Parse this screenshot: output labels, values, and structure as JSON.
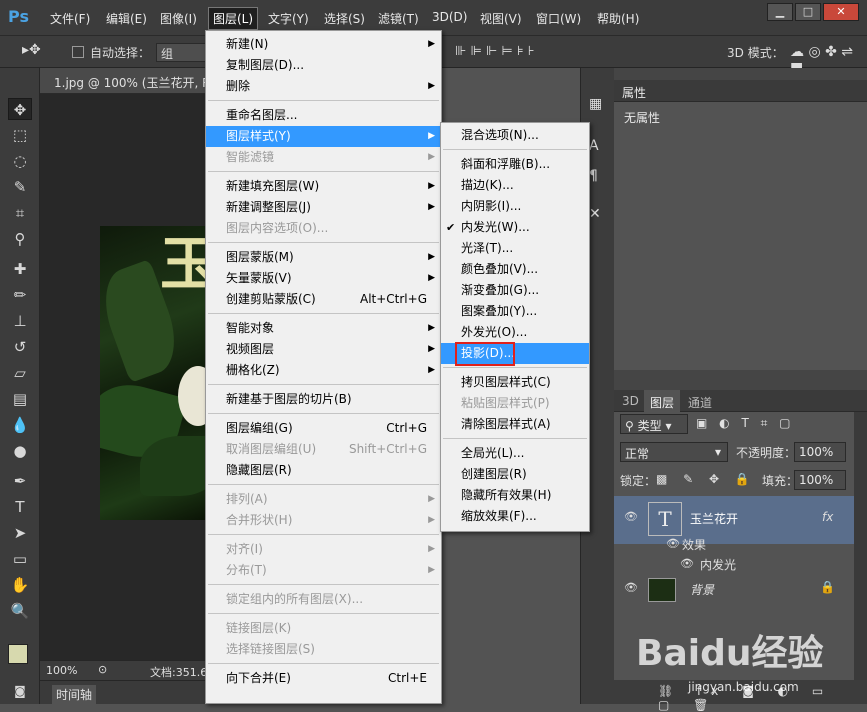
{
  "app": {
    "logo": "Ps"
  },
  "menubar": {
    "items": [
      "文件(F)",
      "编辑(E)",
      "图像(I)",
      "图层(L)",
      "文字(Y)",
      "选择(S)",
      "滤镜(T)",
      "3D(D)",
      "视图(V)",
      "窗口(W)",
      "帮助(H)"
    ],
    "active": "图层(L)"
  },
  "window_buttons": {
    "minimize": "▁",
    "restore": "□",
    "close": "✕"
  },
  "options": {
    "auto_select": "自动选择：",
    "group": "组",
    "mode_3d": "3D 模式："
  },
  "document": {
    "tab": "1.jpg @ 100% (玉兰花开, RG",
    "zoom": "100%",
    "doc_info": "文档:351.6",
    "timeline": "时间轴",
    "canvas_text": "玉"
  },
  "layer_menu": {
    "items": [
      {
        "label": "新建(N)",
        "submenu": true
      },
      {
        "label": "复制图层(D)..."
      },
      {
        "label": "删除",
        "submenu": true
      },
      {
        "sep": true
      },
      {
        "label": "重命名图层..."
      },
      {
        "label": "图层样式(Y)",
        "submenu": true,
        "highlight": true
      },
      {
        "label": "智能滤镜",
        "disabled": true,
        "submenu": true
      },
      {
        "sep": true
      },
      {
        "label": "新建填充图层(W)",
        "submenu": true
      },
      {
        "label": "新建调整图层(J)",
        "submenu": true
      },
      {
        "label": "图层内容选项(O)...",
        "disabled": true
      },
      {
        "sep": true
      },
      {
        "label": "图层蒙版(M)",
        "submenu": true
      },
      {
        "label": "矢量蒙版(V)",
        "submenu": true
      },
      {
        "label": "创建剪贴蒙版(C)",
        "shortcut": "Alt+Ctrl+G"
      },
      {
        "sep": true
      },
      {
        "label": "智能对象",
        "submenu": true
      },
      {
        "label": "视频图层",
        "submenu": true
      },
      {
        "label": "栅格化(Z)",
        "submenu": true
      },
      {
        "sep": true
      },
      {
        "label": "新建基于图层的切片(B)"
      },
      {
        "sep": true
      },
      {
        "label": "图层编组(G)",
        "shortcut": "Ctrl+G"
      },
      {
        "label": "取消图层编组(U)",
        "shortcut": "Shift+Ctrl+G",
        "disabled": true
      },
      {
        "label": "隐藏图层(R)"
      },
      {
        "sep": true
      },
      {
        "label": "排列(A)",
        "submenu": true,
        "disabled": true
      },
      {
        "label": "合并形状(H)",
        "submenu": true,
        "disabled": true
      },
      {
        "sep": true
      },
      {
        "label": "对齐(I)",
        "submenu": true,
        "disabled": true
      },
      {
        "label": "分布(T)",
        "submenu": true,
        "disabled": true
      },
      {
        "sep": true
      },
      {
        "label": "锁定组内的所有图层(X)...",
        "disabled": true
      },
      {
        "sep": true
      },
      {
        "label": "链接图层(K)",
        "disabled": true
      },
      {
        "label": "选择链接图层(S)",
        "disabled": true
      },
      {
        "sep": true
      },
      {
        "label": "向下合并(E)",
        "shortcut": "Ctrl+E"
      }
    ]
  },
  "style_menu": {
    "items": [
      {
        "label": "混合选项(N)..."
      },
      {
        "sep": true
      },
      {
        "label": "斜面和浮雕(B)..."
      },
      {
        "label": "描边(K)..."
      },
      {
        "label": "内阴影(I)..."
      },
      {
        "label": "内发光(W)...",
        "checked": true
      },
      {
        "label": "光泽(T)..."
      },
      {
        "label": "颜色叠加(V)..."
      },
      {
        "label": "渐变叠加(G)..."
      },
      {
        "label": "图案叠加(Y)..."
      },
      {
        "label": "外发光(O)..."
      },
      {
        "label": "投影(D)...",
        "highlight": true
      },
      {
        "sep": true
      },
      {
        "label": "拷贝图层样式(C)"
      },
      {
        "label": "粘贴图层样式(P)",
        "disabled": true
      },
      {
        "label": "清除图层样式(A)"
      },
      {
        "sep": true
      },
      {
        "label": "全局光(L)..."
      },
      {
        "label": "创建图层(R)"
      },
      {
        "label": "隐藏所有效果(H)"
      },
      {
        "label": "缩放效果(F)..."
      }
    ]
  },
  "properties": {
    "tab": "属性",
    "content": "无属性"
  },
  "layers": {
    "tabs": [
      "3D",
      "图层",
      "通道"
    ],
    "kind_filter": "类型",
    "blend_mode": "正常",
    "opacity_label": "不透明度：",
    "opacity": "100%",
    "lock_label": "锁定：",
    "fill_label": "填充：",
    "fill": "100%",
    "text_layer": {
      "name": "玉兰花开",
      "fx": "fx",
      "thumb": "T"
    },
    "effects_label": "效果",
    "effect_item": "内发光",
    "background_layer": {
      "name": "背景"
    }
  },
  "watermark": {
    "brand": "Baidu经验",
    "url": "jingyan.baidu.com"
  },
  "colors": {
    "menu_highlight": "#3399ff",
    "selected_layer": "#5a6e8c",
    "callout": "#e0211c"
  }
}
